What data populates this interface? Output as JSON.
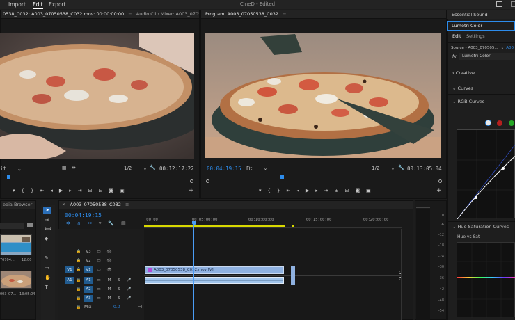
{
  "menu": {
    "import": "Import",
    "edit": "Edit",
    "export": "Export"
  },
  "app_title": "CineD - Edited",
  "source_panel": {
    "tab1": "0538_C032: A003_07050538_C032.mov: 00:00:00:00",
    "tab2": "Audio Clip Mixer: A003_07050538_C032",
    "fit_label": "it",
    "res_label": "1/2",
    "timecode": "00:12:17:22"
  },
  "program_panel": {
    "tab": "Program: A003_07050538_C032",
    "timecode": "00:04:19:15",
    "fit_label": "Fit",
    "res_label": "1/2",
    "duration": "00:13:05:04"
  },
  "project_panel": {
    "tab": "edia Browser",
    "thumb1_name": "76704...",
    "thumb1_dur": "12:00",
    "thumb2_name": "003_07...",
    "thumb2_dur": "13:05:04"
  },
  "timeline": {
    "tab": "A003_07050538_C032",
    "timecode": "00:04:19:15",
    "ruler": [
      ":00:00",
      "00:05:00:00",
      "00:10:00:00",
      "00:15:00:00",
      "00:20:00:00"
    ],
    "video_tracks": [
      "V3",
      "V2",
      "V1"
    ],
    "audio_tracks": [
      "A1",
      "A2",
      "A3"
    ],
    "source_patch": {
      "v": "V1",
      "a": "A1"
    },
    "mix_label": "Mix",
    "mix_value": "0.0",
    "clip_video_label": "A003_07050538_C032.mov [V]",
    "m_label": "M",
    "s_label": "S"
  },
  "meter_labels": [
    "0",
    "-6",
    "-12",
    "-18",
    "-24",
    "-30",
    "-36",
    "-42",
    "-48",
    "-54"
  ],
  "right_panel": {
    "essential_sound": "Essential Sound",
    "lumetri_color": "Lumetri Color",
    "tab_edit": "Edit",
    "tab_settings": "Settings",
    "source": "Source - A003_070505...",
    "fx_label": "fx",
    "fx_name": "Lumetri Color",
    "creative": "Creative",
    "curves": "Curves",
    "rgb_curves": "RGB Curves",
    "hue_sat_curves": "Hue Saturation Curves",
    "hue_vs_sat": "Hue vs Sat"
  },
  "colors": {
    "accent": "#2d8ceb",
    "clip_video": "#8fb1e0",
    "clip_audio": "#9fc3ea",
    "playhead": "#4a9cf5",
    "work_area": "#d8d800"
  }
}
